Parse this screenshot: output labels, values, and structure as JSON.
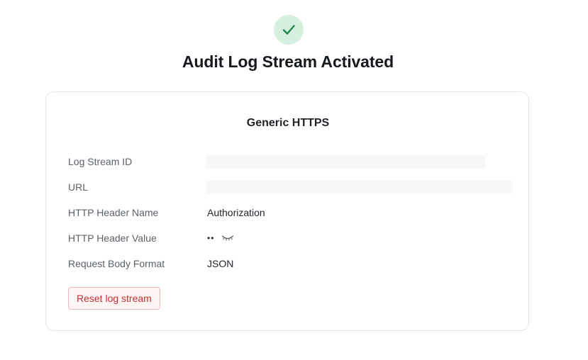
{
  "header": {
    "title": "Audit Log Stream Activated",
    "status_icon": "checkmark-icon",
    "accent_color": "#1f8a4c",
    "accent_bg": "#d6efdf"
  },
  "card": {
    "title": "Generic HTTPS",
    "rows": [
      {
        "label": "Log Stream ID",
        "value": ""
      },
      {
        "label": "URL",
        "value": ""
      },
      {
        "label": "HTTP Header Name",
        "value": "Authorization"
      },
      {
        "label": "HTTP Header Value",
        "value": "••",
        "toggle_icon": "eye-closed-icon"
      },
      {
        "label": "Request Body Format",
        "value": "JSON"
      }
    ],
    "reset_label": "Reset log stream",
    "danger_color": "#c43030"
  }
}
